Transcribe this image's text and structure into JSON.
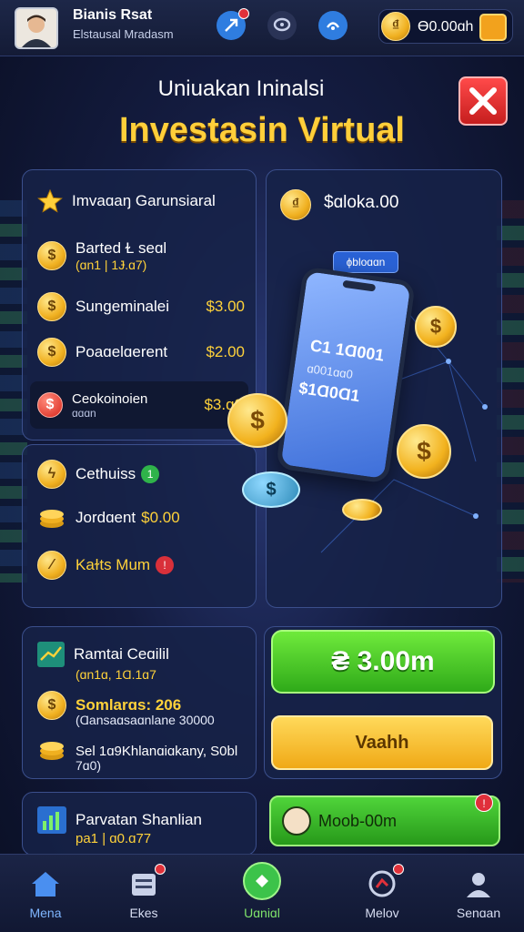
{
  "header": {
    "user_name": "Bianis Rsat",
    "user_subtitle": "Elstausal Mradasm",
    "balance": "Ɵ0.00ɑh",
    "icons": [
      "rocket-icon",
      "chat-icon",
      "headset-icon",
      "wallet-icon"
    ]
  },
  "hero": {
    "subtitle": "Uniuakan Ininalsi",
    "title": "Investasin Virtual",
    "balance": "$ɑloka.00",
    "phone_tag": "ɸbloɑɑn",
    "phone_line1": "C1 1Ɑ001",
    "phone_line2": "ɑ001ɑɑ0",
    "phone_line3": "$1Ɑ0Ɑ1"
  },
  "card_top": {
    "title": "Imvaɑaŋ Garunsiaral",
    "rows": [
      {
        "label": "Barted Ɫ seɑl",
        "sub": "(ɑn1 | 1Ɉ.ɑ7)",
        "value": ""
      },
      {
        "label": "Sungeminalei",
        "value": "$3.00"
      },
      {
        "label": "Poaɑelɑerent",
        "value": "$2.00"
      },
      {
        "label": "Ceokoinoien",
        "sub": "ɑɑɑn",
        "value": "$3.ɑ0"
      }
    ]
  },
  "card_mid": {
    "rows": [
      {
        "label": "Cethuiss",
        "badge": "1"
      },
      {
        "label": "Jordɑent",
        "value": "$0.00"
      },
      {
        "label": "Kaɫts Mum",
        "badge": "!"
      }
    ]
  },
  "card_portfolio": {
    "title": "Ramtai Ceɑilil",
    "sub1": "(ɑn1ɑ, 1Ɑ.1ɑ7",
    "line1": "Somlarɑs: 206",
    "line2": "(Ɑansaɑsaɑnlane 30000",
    "line3": "Sel 1ɑ9Khlanɑiɑkany, S0bl",
    "line4": "7ɑ0)"
  },
  "card_bottom": {
    "title": "Parvatan Shanlian",
    "sub": "pa1 | ɑ0.ɑ77"
  },
  "actions": {
    "primary": "₴ 3.00m",
    "secondary": "Vaahh",
    "tertiary": "Moob-00m",
    "tertiary_badge": "!"
  },
  "nav": [
    {
      "label": "Mena",
      "icon": "home-icon"
    },
    {
      "label": "Ekes",
      "icon": "list-icon"
    },
    {
      "label": "Uɑniɑl",
      "icon": "invest-icon"
    },
    {
      "label": "Melov",
      "icon": "chart-icon"
    },
    {
      "label": "Senɑan",
      "icon": "profile-icon"
    }
  ],
  "colors": {
    "accent_gold": "#ffcf3a",
    "primary_green": "#2faa19",
    "panel": "#162248",
    "close_red": "#d62b2b"
  }
}
